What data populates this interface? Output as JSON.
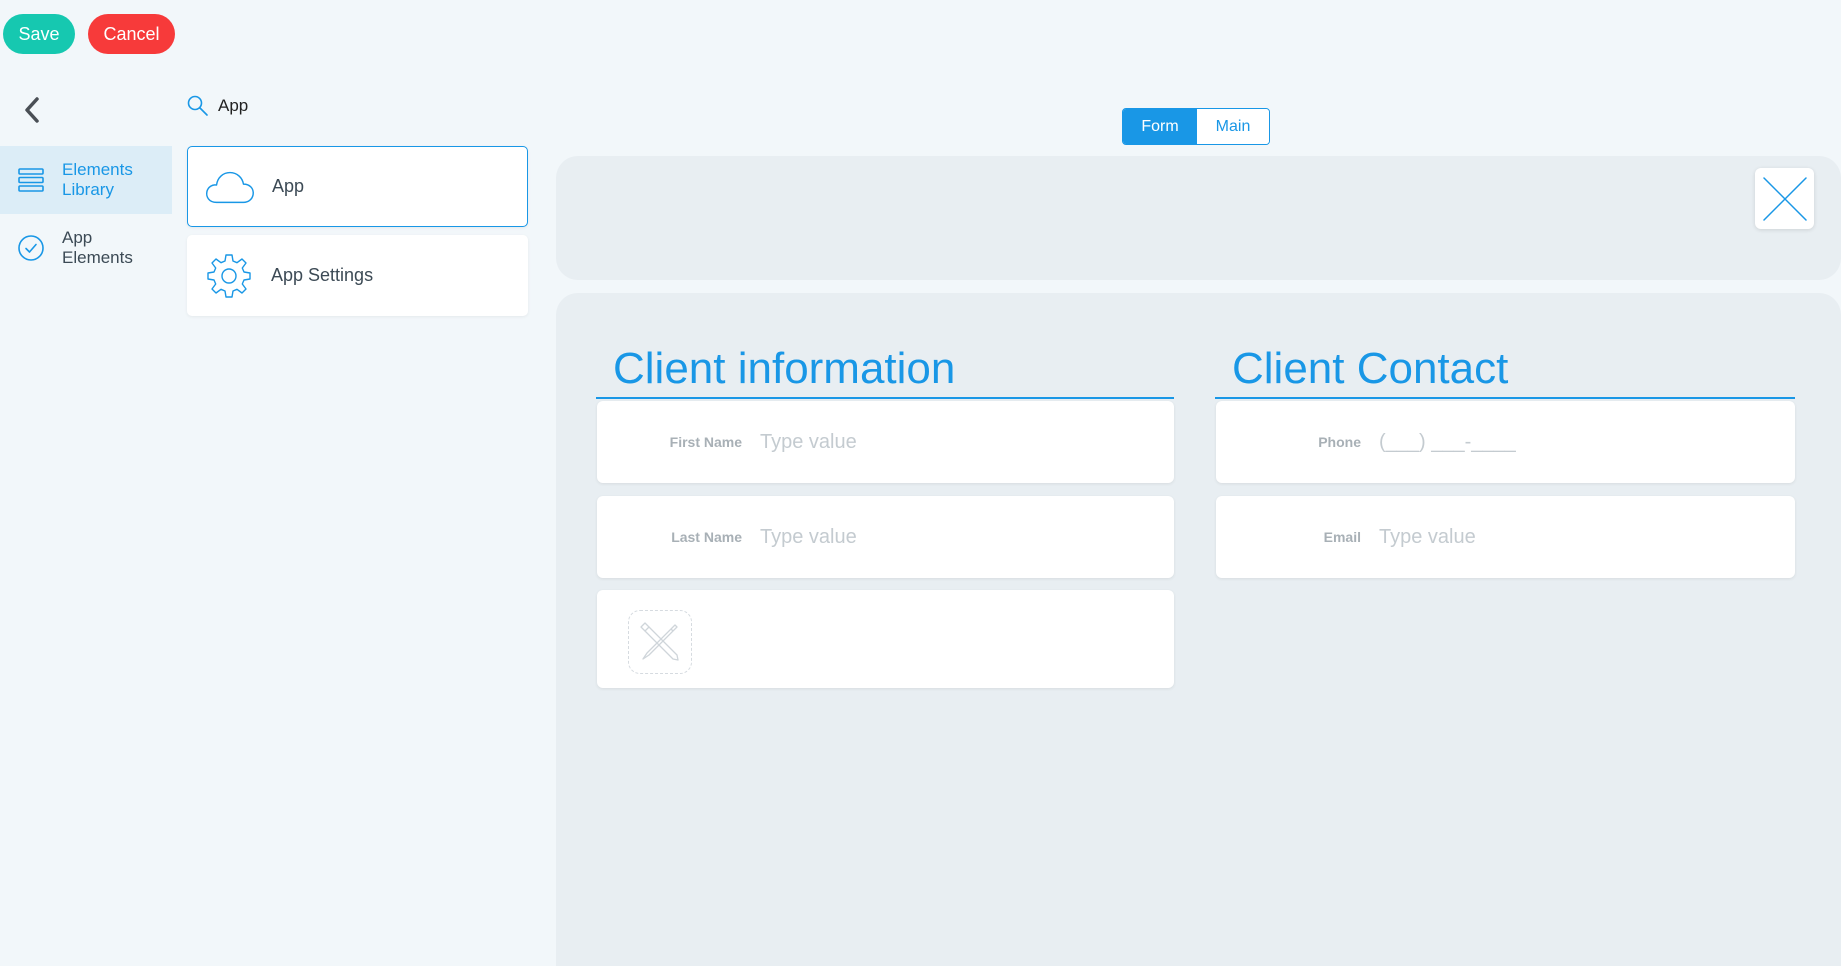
{
  "toolbar": {
    "save_label": "Save",
    "cancel_label": "Cancel"
  },
  "nav": {
    "items": [
      {
        "label": "Elements\nLibrary",
        "icon": "layers-icon",
        "active": true
      },
      {
        "label": "App\nElements",
        "icon": "check-circle-icon",
        "active": false
      }
    ]
  },
  "library": {
    "search_value": "App",
    "items": [
      {
        "label": "App",
        "icon": "cloud-icon",
        "selected": true
      },
      {
        "label": "App Settings",
        "icon": "gear-icon",
        "selected": false
      }
    ]
  },
  "tabs": {
    "form": "Form",
    "main": "Main",
    "active": "Form"
  },
  "form": {
    "client_information": {
      "title": "Client information",
      "fields": [
        {
          "label": "First Name",
          "placeholder": "Type value"
        },
        {
          "label": "Last Name",
          "placeholder": "Type value"
        }
      ]
    },
    "client_contact": {
      "title": "Client Contact",
      "fields": [
        {
          "label": "Phone",
          "placeholder": "(___) ___-____"
        },
        {
          "label": "Email",
          "placeholder": "Type value"
        }
      ]
    }
  },
  "colors": {
    "accent": "#1997e6",
    "save": "#16c8b0",
    "cancel": "#f73a3a",
    "background": "#f2f7fa",
    "panel": "#e8eef2"
  }
}
